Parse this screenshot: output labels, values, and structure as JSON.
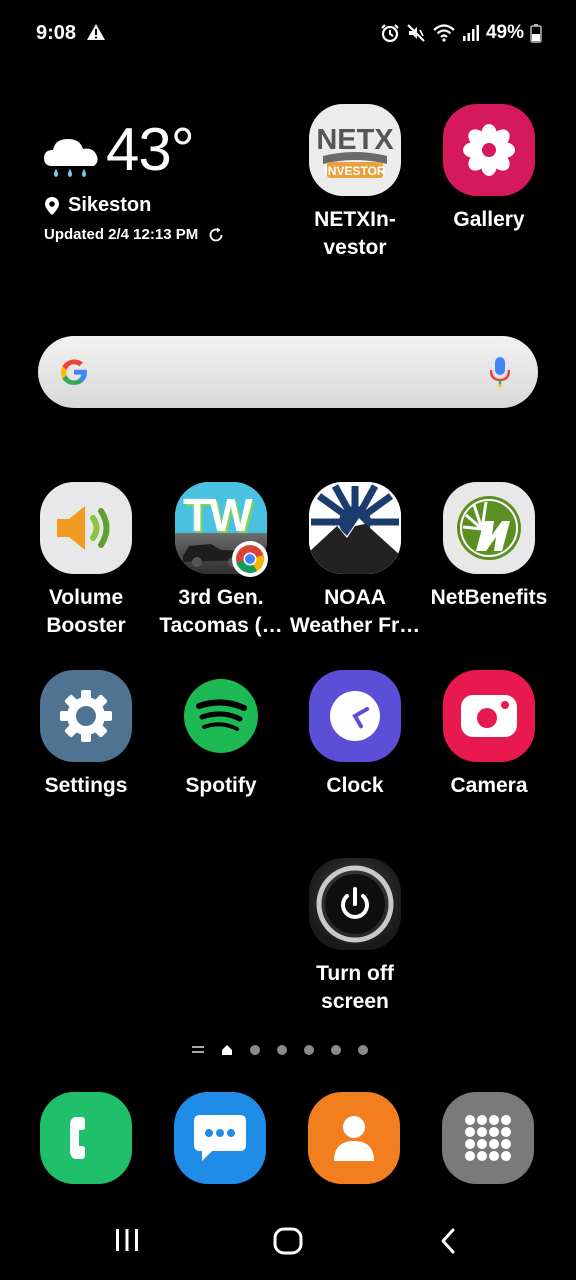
{
  "status_bar": {
    "time": "9:08",
    "battery": "49%",
    "icons": [
      "warning-icon",
      "alarm-icon",
      "mute-icon",
      "wifi-icon",
      "signal-icon",
      "battery-icon"
    ]
  },
  "weather": {
    "temperature": "43°",
    "location": "Sikeston",
    "updated": "Updated 2/4 12:13 PM",
    "condition_icon": "rain-cloud-icon"
  },
  "apps_top": [
    {
      "label": "NETXIn-\nvestor",
      "icon": "netx-investor-icon",
      "color": "#e8e8e8"
    },
    {
      "label": "Gallery",
      "icon": "gallery-flower-icon",
      "color": "#d6195c"
    }
  ],
  "search": {
    "logo": "google-g-icon",
    "mic": "microphone-icon"
  },
  "apps_row1": [
    {
      "label": "Volume\nBooster",
      "icon": "speaker-icon",
      "color": "#e6e6e6"
    },
    {
      "label": "3rd Gen.\nTacomas (…",
      "icon": "tw-icon",
      "color": "#3fb8d8",
      "logo_text": "TW"
    },
    {
      "label": "NOAA\nWeather Fr…",
      "icon": "noaa-mountain-icon",
      "color": "#1b3c6e"
    },
    {
      "label": "NetBenefits",
      "icon": "netbenefits-icon",
      "color": "#e6e6e6"
    }
  ],
  "apps_row2": [
    {
      "label": "Settings",
      "icon": "gear-icon",
      "color": "#4f7390"
    },
    {
      "label": "Spotify",
      "icon": "spotify-icon",
      "color": "#1db954"
    },
    {
      "label": "Clock",
      "icon": "clock-icon",
      "color": "#5b4fd8"
    },
    {
      "label": "Camera",
      "icon": "camera-icon",
      "color": "#e8194f"
    }
  ],
  "apps_row3": [
    {
      "label": "Turn off\nscreen",
      "icon": "power-icon",
      "color": "#2a2a2a"
    }
  ],
  "pager": {
    "pages": 6,
    "current": 1
  },
  "dock": [
    {
      "name": "phone",
      "icon": "phone-icon",
      "color": "#1fbf6b"
    },
    {
      "name": "messages",
      "icon": "messages-icon",
      "color": "#1f8ce8"
    },
    {
      "name": "contacts",
      "icon": "contacts-icon",
      "color": "#f37e1f"
    },
    {
      "name": "app-drawer",
      "icon": "apps-grid-icon",
      "color": "#7a7a7a"
    }
  ],
  "nav": [
    "recents-icon",
    "home-icon",
    "back-icon"
  ]
}
